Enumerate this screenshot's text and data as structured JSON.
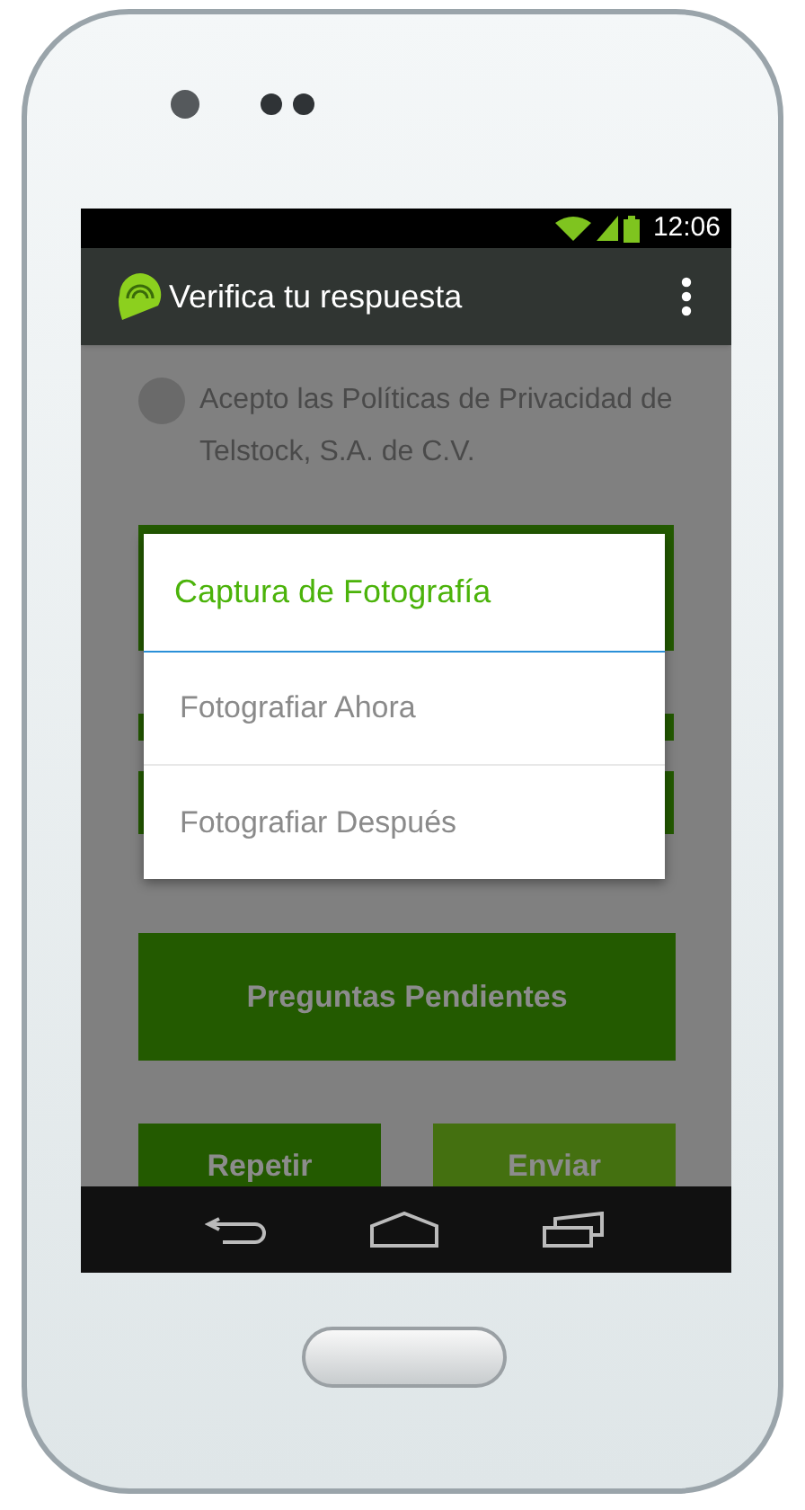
{
  "status_bar": {
    "time": "12:06"
  },
  "app_bar": {
    "title": "Verifica tu respuesta"
  },
  "consent": {
    "text": "Acepto las Políticas de Privacidad de Telstock, S.A. de C.V.",
    "checked": false
  },
  "buttons": [
    {
      "label": "Preguntas Pendientes"
    },
    {
      "label": "Repetir"
    },
    {
      "label": "Enviar"
    }
  ],
  "dialog": {
    "title": "Captura de Fotografía",
    "options": [
      "Fotografiar Ahora",
      "Fotografiar Después"
    ]
  }
}
